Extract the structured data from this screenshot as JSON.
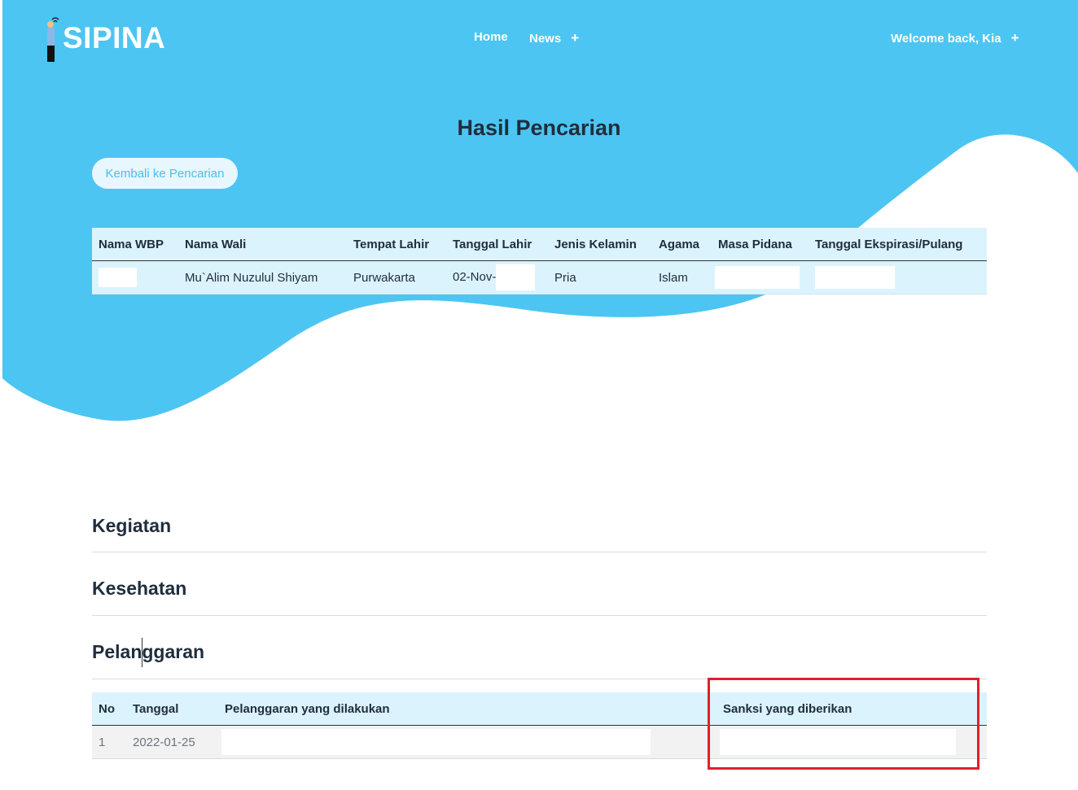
{
  "brand": {
    "name": "SIPINA"
  },
  "nav": {
    "home_label": "Home",
    "news_label": "News",
    "news_toggle": "+",
    "user_label": "Welcome back, Kia",
    "user_toggle": "+"
  },
  "colors": {
    "header": "#4cc5f2",
    "accent": "#46c1ef",
    "table_bg": "#dbf3fd",
    "highlight": "#e0202a"
  },
  "page": {
    "title": "Hasil Pencarian",
    "back_button": "Kembali ke Pencarian"
  },
  "profile_table": {
    "columns": [
      "Nama WBP",
      "Nama Wali",
      "Tempat Lahir",
      "Tanggal Lahir",
      "Jenis Kelamin",
      "Agama",
      "Masa Pidana",
      "Tanggal Ekspirasi/Pulang"
    ],
    "row": {
      "nama_wbp": "",
      "nama_wali": "Mu`Alim Nuzulul Shiyam",
      "tempat_lahir": "Purwakarta",
      "tanggal_lahir": "02-Nov-",
      "jenis_kelamin": "Pria",
      "agama": "Islam",
      "masa_pidana": "",
      "tanggal_ekspirasi": ""
    }
  },
  "sections": {
    "kegiatan": "Kegiatan",
    "kesehatan": "Kesehatan",
    "pelanggaran": "Pelanggaran"
  },
  "violation_table": {
    "columns": [
      "No",
      "Tanggal",
      "Pelanggaran yang dilakukan",
      "Sanksi yang diberikan"
    ],
    "rows": [
      {
        "no": "1",
        "tanggal": "2022-01-25",
        "pelanggaran": "",
        "sanksi": ""
      }
    ]
  },
  "icons": {
    "logo": "prisoner-figure-icon"
  }
}
